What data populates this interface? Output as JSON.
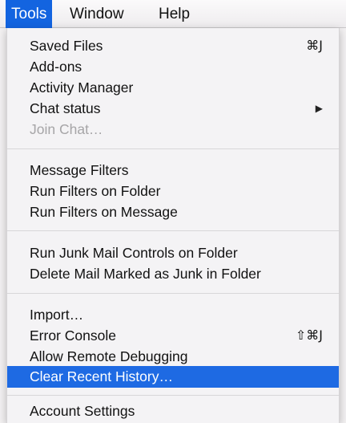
{
  "menubar": {
    "items": [
      "Tools",
      "Window",
      "Help"
    ]
  },
  "menu": {
    "saved_files": {
      "label": "Saved Files",
      "shortcut": "⌘J"
    },
    "addons": "Add-ons",
    "activity_manager": "Activity Manager",
    "chat_status": {
      "label": "Chat status",
      "arrow": "▶"
    },
    "join_chat": "Join Chat…",
    "message_filters": "Message Filters",
    "run_filters_folder": "Run Filters on Folder",
    "run_filters_message": "Run Filters on Message",
    "run_junk_controls": "Run Junk Mail Controls on Folder",
    "delete_junk": "Delete Mail Marked as Junk in Folder",
    "import": "Import…",
    "error_console": {
      "label": "Error Console",
      "shortcut": "⇧⌘J"
    },
    "allow_remote_debugging": "Allow Remote Debugging",
    "clear_recent_history": "Clear Recent History…",
    "account_settings": "Account Settings"
  },
  "colors": {
    "highlight": "#1e6ae3",
    "menubar_active": "#1364e0",
    "disabled_text": "#a6a5a7"
  }
}
